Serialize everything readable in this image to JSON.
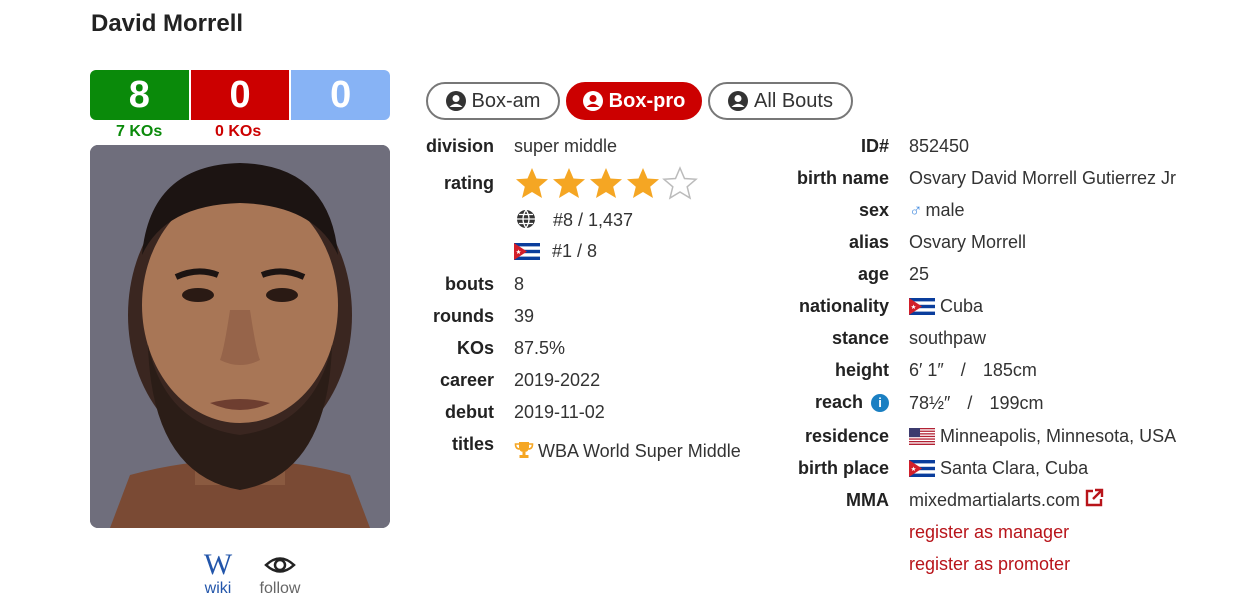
{
  "fighter": {
    "name": "David Morrell"
  },
  "record": {
    "wins": "8",
    "losses": "0",
    "draws": "0",
    "win_kos": "7 KOs",
    "loss_kos": "0 KOs"
  },
  "links": {
    "wiki_label": "wiki",
    "wiki_letter": "W",
    "follow_label": "follow"
  },
  "tabs": [
    {
      "label": "Box-am",
      "active": false
    },
    {
      "label": "Box-pro",
      "active": true
    },
    {
      "label": "All Bouts",
      "active": false
    }
  ],
  "left_info": {
    "division": {
      "label": "division",
      "value": "super middle"
    },
    "rating": {
      "label": "rating",
      "stars_filled": 4,
      "stars_total": 5,
      "world_rank": "#8 / 1,437",
      "country_rank": "#1 / 8"
    },
    "bouts": {
      "label": "bouts",
      "value": "8"
    },
    "rounds": {
      "label": "rounds",
      "value": "39"
    },
    "kos": {
      "label": "KOs",
      "value": "87.5%"
    },
    "career": {
      "label": "career",
      "value": "2019-2022"
    },
    "debut": {
      "label": "debut",
      "value": "2019-11-02"
    },
    "titles": {
      "label": "titles",
      "value": "WBA World Super Middle"
    }
  },
  "right_info": {
    "id": {
      "label": "ID#",
      "value": "852450"
    },
    "birth_name": {
      "label": "birth name",
      "value": "Osvary David Morrell Gutierrez Jr"
    },
    "sex": {
      "label": "sex",
      "value": "male",
      "icon": "male-icon"
    },
    "alias": {
      "label": "alias",
      "value": "Osvary Morrell"
    },
    "age": {
      "label": "age",
      "value": "25"
    },
    "nationality": {
      "label": "nationality",
      "value": "Cuba",
      "icon": "cuba-flag-icon"
    },
    "stance": {
      "label": "stance",
      "value": "southpaw"
    },
    "height": {
      "label": "height",
      "imperial": "6′ 1″",
      "sep": "/",
      "metric": "185cm"
    },
    "reach": {
      "label": "reach",
      "imperial": "78½″",
      "sep": "/",
      "metric": "199cm"
    },
    "residence": {
      "label": "residence",
      "value": "Minneapolis, Minnesota, USA",
      "icon": "usa-flag-icon"
    },
    "birth_place": {
      "label": "birth place",
      "value": "Santa Clara, Cuba",
      "icon": "cuba-flag-icon"
    },
    "mma": {
      "label": "MMA",
      "value": "mixedmartialarts.com"
    },
    "register_manager": "register as manager",
    "register_promoter": "register as promoter"
  },
  "colors": {
    "win": "#0a8a0a",
    "loss": "#cc0000",
    "draw": "#87b3f5",
    "star": "#f5a623",
    "link_red": "#b8141a"
  }
}
